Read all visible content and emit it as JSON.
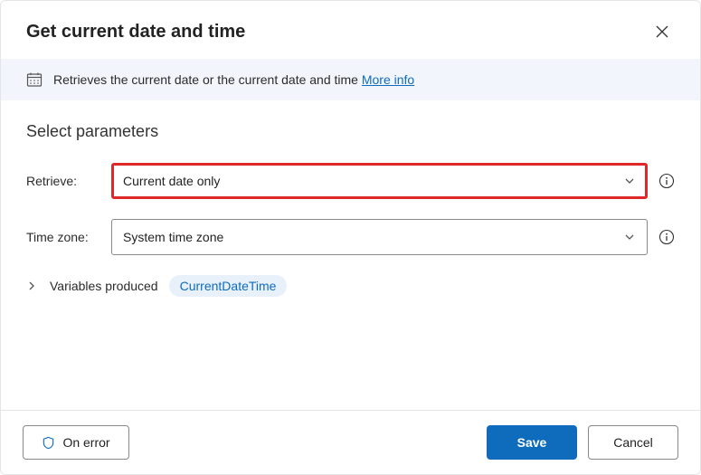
{
  "header": {
    "title": "Get current date and time"
  },
  "subtitle": {
    "text": "Retrieves the current date or the current date and time",
    "more_info": "More info"
  },
  "section": {
    "heading": "Select parameters"
  },
  "params": {
    "retrieve": {
      "label": "Retrieve:",
      "value": "Current date only"
    },
    "timezone": {
      "label": "Time zone:",
      "value": "System time zone"
    }
  },
  "variables": {
    "label": "Variables produced",
    "pill": "CurrentDateTime"
  },
  "footer": {
    "on_error": "On error",
    "save": "Save",
    "cancel": "Cancel"
  }
}
